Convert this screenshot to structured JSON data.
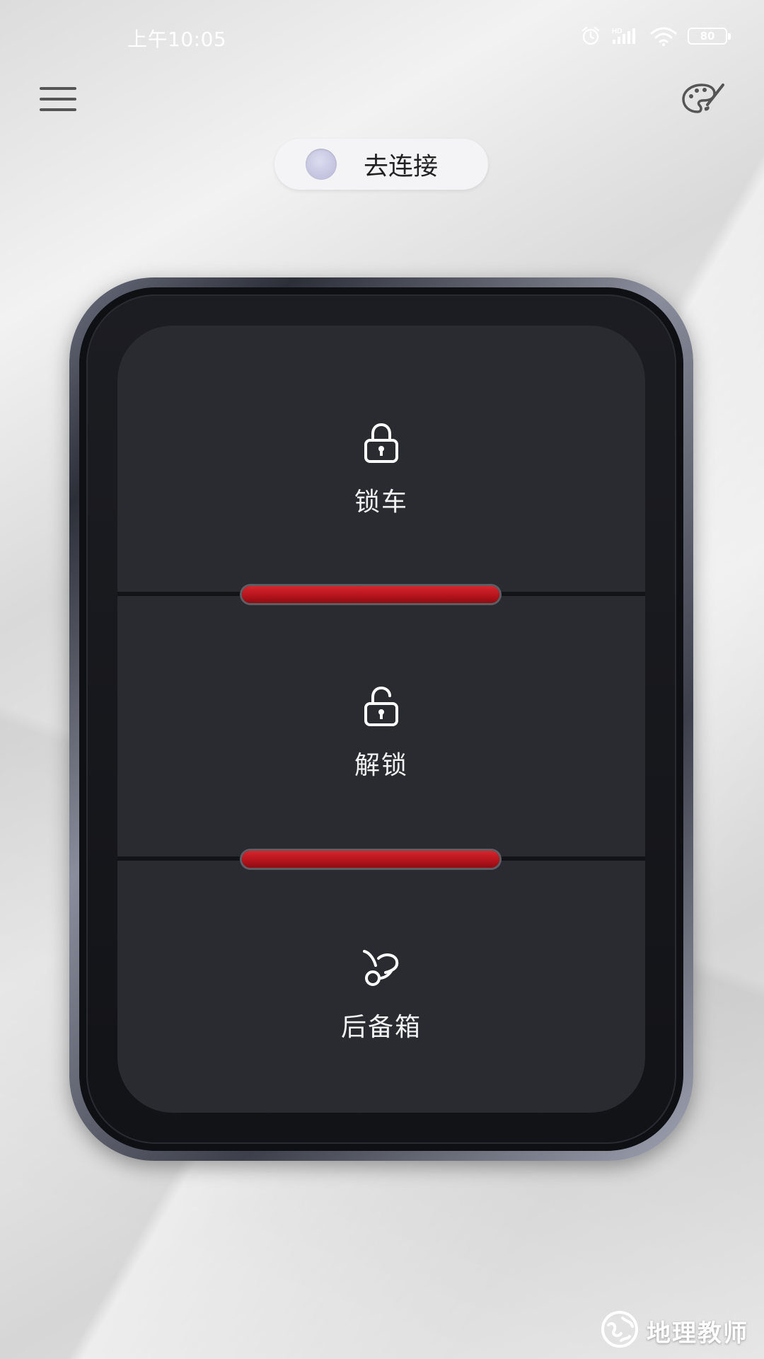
{
  "status_bar": {
    "time": "上午10:05",
    "battery_level": "80",
    "icons": [
      "alarm-icon",
      "hd-signal-icon",
      "wifi-icon",
      "battery-icon"
    ]
  },
  "toolbar": {
    "menu_icon": "hamburger-menu-icon",
    "theme_icon": "palette-icon"
  },
  "connect": {
    "label": "去连接",
    "status_color": "#c4c4de"
  },
  "fob": {
    "buttons": [
      {
        "label": "锁车",
        "icon": "lock-icon"
      },
      {
        "label": "解锁",
        "icon": "unlock-icon"
      },
      {
        "label": "后备箱",
        "icon": "trunk-icon"
      }
    ],
    "indicator_color": "#c8181f"
  },
  "watermark": {
    "text": "地理教师"
  }
}
